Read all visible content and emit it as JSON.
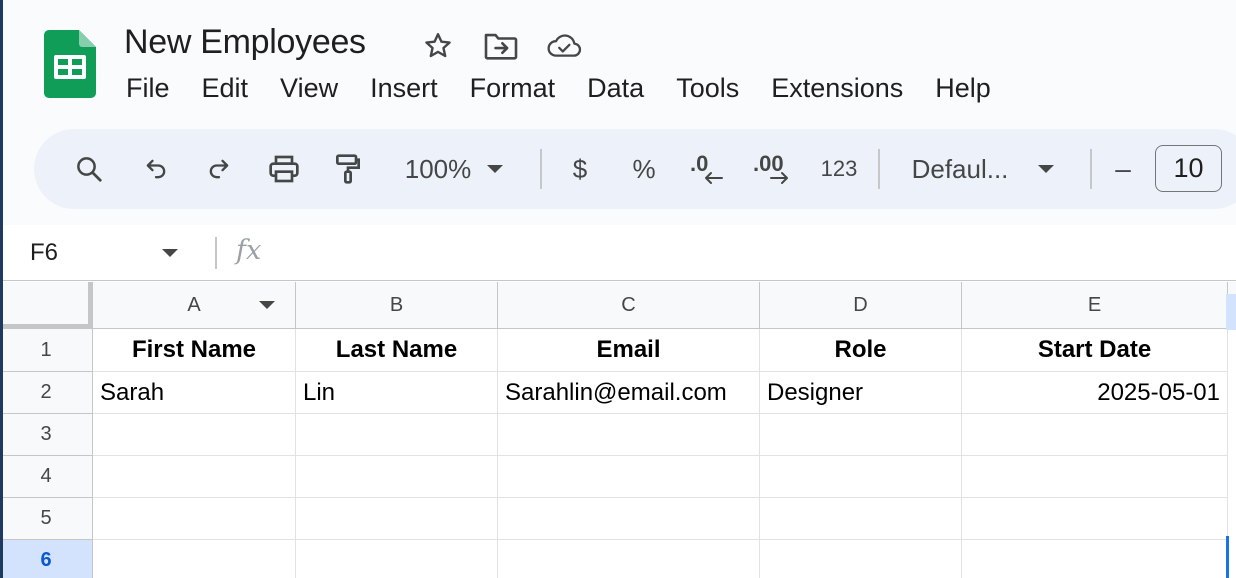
{
  "app": {
    "logo_icon": "google-sheets-logo",
    "document_title": "New Employees",
    "title_icons": [
      "star-icon",
      "move-to-folder-icon",
      "cloud-saved-icon"
    ]
  },
  "menu": [
    "File",
    "Edit",
    "View",
    "Insert",
    "Format",
    "Data",
    "Tools",
    "Extensions",
    "Help"
  ],
  "toolbar": {
    "search_icon": "search-icon",
    "undo_icon": "undo-icon",
    "redo_icon": "redo-icon",
    "print_icon": "print-icon",
    "paint_format_icon": "paint-format-icon",
    "zoom": "100%",
    "currency": "$",
    "percent": "%",
    "decrease_decimal": ".0",
    "increase_decimal": ".00",
    "number_format": "123",
    "font": "Defaul...",
    "font_size_decrease": "–",
    "font_size": "10"
  },
  "formula_bar": {
    "name_box": "F6",
    "fx_label": "fx",
    "formula": ""
  },
  "sheet": {
    "columns": [
      "A",
      "B",
      "C",
      "D",
      "E"
    ],
    "rows": [
      "1",
      "2",
      "3",
      "4",
      "5",
      "6"
    ],
    "selected_cell": "F6",
    "cells": [
      [
        "First Name",
        "Last Name",
        "Email",
        "Role",
        "Start Date"
      ],
      [
        "Sarah",
        "Lin",
        "Sarahlin@email.com",
        "Designer",
        "2025-05-01"
      ],
      [
        "",
        "",
        "",
        "",
        ""
      ],
      [
        "",
        "",
        "",
        "",
        ""
      ],
      [
        "",
        "",
        "",
        "",
        ""
      ],
      [
        "",
        "",
        "",
        "",
        ""
      ]
    ]
  },
  "colors": {
    "sheets_green": "#0f9d58",
    "toolbar_bg": "#edf2fa",
    "selection_blue": "#1a73e8",
    "selected_header_bg": "#d3e3fd"
  }
}
